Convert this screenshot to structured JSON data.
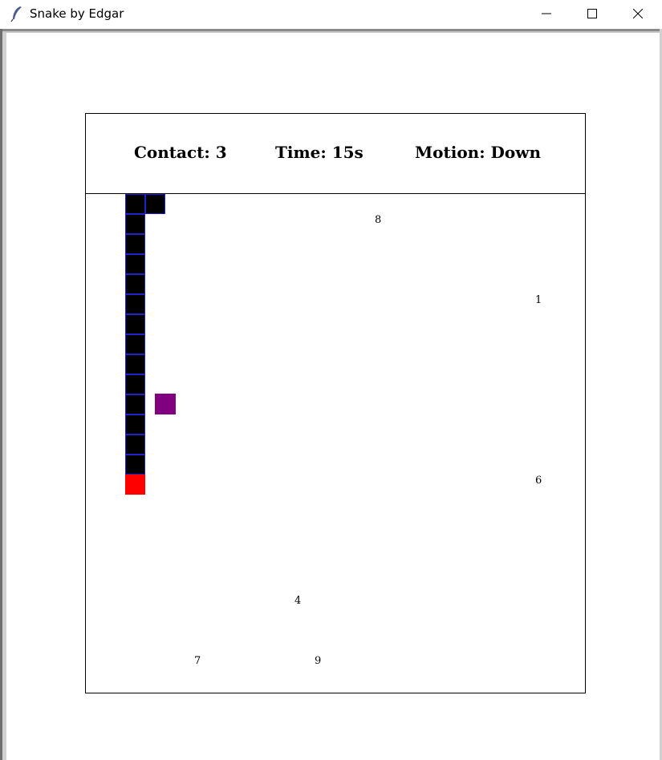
{
  "window": {
    "title": "Snake by Edgar",
    "icon": "feather-icon",
    "controls": [
      "minimize-icon",
      "maximize-icon",
      "close-icon"
    ]
  },
  "hud": {
    "contact": "Contact: 3",
    "time": "Time: 15s",
    "motion": "Motion: Down"
  },
  "numbers": [
    "8",
    "1",
    "6",
    "4",
    "7",
    "9"
  ],
  "colors": {
    "snake_body": "#000000",
    "snake_border": "#2222cc",
    "snake_head": "#ff0000",
    "food": "#800080"
  }
}
